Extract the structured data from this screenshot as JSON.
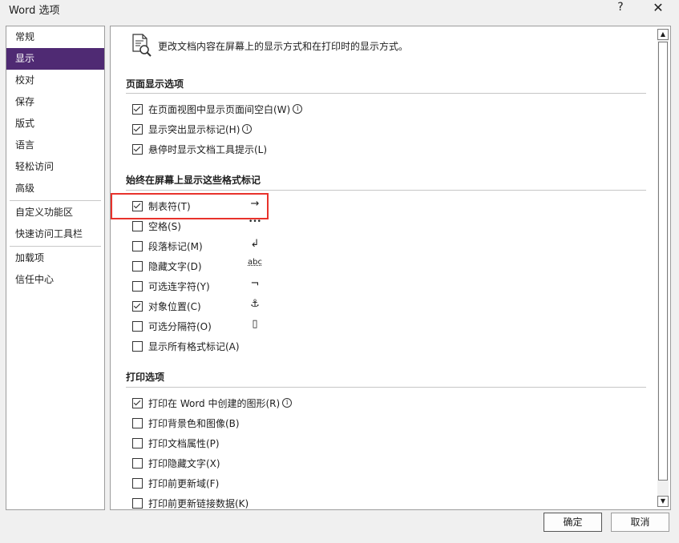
{
  "window": {
    "title": "Word 选项",
    "help_label": "?",
    "close_label": "✕"
  },
  "sidebar": {
    "items": [
      {
        "label": "常规"
      },
      {
        "label": "显示"
      },
      {
        "label": "校对"
      },
      {
        "label": "保存"
      },
      {
        "label": "版式"
      },
      {
        "label": "语言"
      },
      {
        "label": "轻松访问"
      },
      {
        "label": "高级"
      },
      {
        "label": "自定义功能区"
      },
      {
        "label": "快速访问工具栏"
      },
      {
        "label": "加载项"
      },
      {
        "label": "信任中心"
      }
    ],
    "selected": "显示"
  },
  "main": {
    "intro": "更改文档内容在屏幕上的显示方式和在打印时的显示方式。",
    "page_display": {
      "title": "页面显示选项",
      "options": [
        {
          "label": "在页面视图中显示页面间空白(W)",
          "checked": true,
          "info": "i"
        },
        {
          "label": "显示突出显示标记(H)",
          "checked": true,
          "info": "i"
        },
        {
          "label": "悬停时显示文档工具提示(L)",
          "checked": true
        }
      ]
    },
    "formatting_marks": {
      "title": "始终在屏幕上显示这些格式标记",
      "options": [
        {
          "label": "制表符(T)",
          "checked": true,
          "glyph": "→"
        },
        {
          "label": "空格(S)",
          "checked": false,
          "glyph": "•••"
        },
        {
          "label": "段落标记(M)",
          "checked": false,
          "glyph": "↲"
        },
        {
          "label": "隐藏文字(D)",
          "checked": false,
          "glyph": "abc"
        },
        {
          "label": "可选连字符(Y)",
          "checked": false,
          "glyph": "¬"
        },
        {
          "label": "对象位置(C)",
          "checked": true,
          "glyph": "⚓"
        },
        {
          "label": "可选分隔符(O)",
          "checked": false,
          "glyph": "▯"
        },
        {
          "label": "显示所有格式标记(A)",
          "checked": false
        }
      ]
    },
    "print": {
      "title": "打印选项",
      "options": [
        {
          "label": "打印在 Word 中创建的图形(R)",
          "checked": true,
          "info": "i"
        },
        {
          "label": "打印背景色和图像(B)",
          "checked": false
        },
        {
          "label": "打印文档属性(P)",
          "checked": false
        },
        {
          "label": "打印隐藏文字(X)",
          "checked": false
        },
        {
          "label": "打印前更新域(F)",
          "checked": false
        },
        {
          "label": "打印前更新链接数据(K)",
          "checked": false
        }
      ]
    }
  },
  "buttons": {
    "ok": "确定",
    "cancel": "取消"
  },
  "colors": {
    "selected_nav": "#4f2a73",
    "highlight": "#e8322b"
  }
}
